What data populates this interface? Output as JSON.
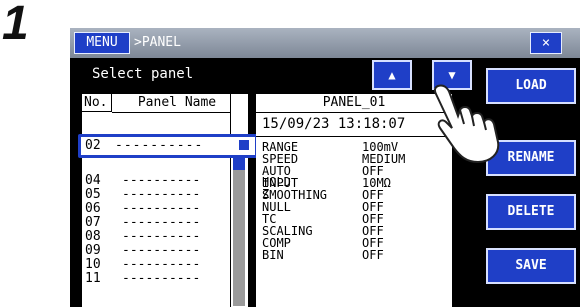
{
  "step_number": "1",
  "titlebar": {
    "menu_label": "MENU",
    "breadcrumb": ">PANEL",
    "close_label": "×"
  },
  "heading": "Select panel",
  "nav": {
    "up_label": "▲",
    "down_label": "▼"
  },
  "side_buttons": {
    "load": "LOAD",
    "rename": "RENAME",
    "delete": "DELETE",
    "save": "SAVE"
  },
  "table": {
    "col_no": "No.",
    "col_name": "Panel Name",
    "rows": [
      {
        "no": "04",
        "name": "----------"
      },
      {
        "no": "05",
        "name": "----------"
      },
      {
        "no": "06",
        "name": "----------"
      },
      {
        "no": "07",
        "name": "----------"
      },
      {
        "no": "08",
        "name": "----------"
      },
      {
        "no": "09",
        "name": "----------"
      },
      {
        "no": "10",
        "name": "----------"
      },
      {
        "no": "11",
        "name": "----------"
      }
    ],
    "selected": {
      "no": "02",
      "name": "----------"
    }
  },
  "detail": {
    "title": "PANEL_01",
    "datetime": "15/09/23 13:18:07",
    "params": [
      {
        "key": "RANGE",
        "value": "100mV"
      },
      {
        "key": "SPEED",
        "value": "MEDIUM"
      },
      {
        "key": "AUTO HOLD",
        "value": "OFF"
      },
      {
        "key": "INPUT Z",
        "value": "10MΩ"
      },
      {
        "key": "SMOOTHING",
        "value": "OFF"
      },
      {
        "key": "NULL",
        "value": "OFF"
      },
      {
        "key": "TC",
        "value": "OFF"
      },
      {
        "key": "SCALING",
        "value": "OFF"
      },
      {
        "key": "COMP",
        "value": "OFF"
      },
      {
        "key": "BIN",
        "value": "OFF"
      }
    ]
  },
  "colors": {
    "accent": "#1f3fc7",
    "screen": "#000000",
    "panel": "#ffffff"
  }
}
